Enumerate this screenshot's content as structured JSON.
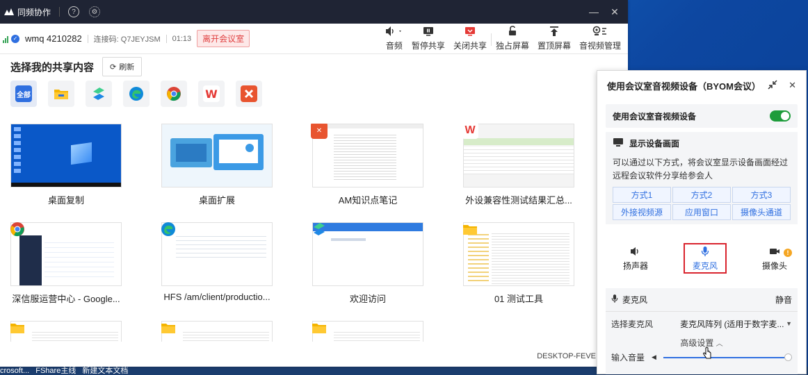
{
  "colors": {
    "accent": "#2f6fe0",
    "danger": "#e04040",
    "toggle_on": "#1e9c3b",
    "titlebar": "#1f2434",
    "highlight": "#d9232d"
  },
  "window": {
    "title": "同频协作",
    "help_icon": "help-circle-icon",
    "settings_icon": "gear-icon",
    "minimize": "—",
    "close": "✕"
  },
  "info": {
    "user": "wmq 4210282",
    "code": "连接码: Q7JEYJSM",
    "time": "01:13",
    "leave": "离开会议室"
  },
  "toolbar": [
    {
      "label": "音频",
      "icon": "speaker-icon"
    },
    {
      "label": "暂停共享",
      "icon": "pause-screen-icon"
    },
    {
      "label": "关闭共享",
      "icon": "stop-share-icon"
    },
    {
      "label": "独占屏幕",
      "icon": "lock-icon"
    },
    {
      "label": "置顶屏幕",
      "icon": "pin-top-icon"
    },
    {
      "label": "音视频管理",
      "icon": "av-manage-icon"
    }
  ],
  "share": {
    "title": "选择我的共享内容",
    "refresh": "刷新"
  },
  "filters": [
    {
      "name": "all",
      "label": "全部",
      "icon": "all-icon",
      "color": "#2f6fe0"
    },
    {
      "name": "explorer",
      "label": "",
      "icon": "folder-icon",
      "color": "#f4b400"
    },
    {
      "name": "app-s",
      "label": "",
      "icon": "s-app-icon",
      "color": "#22a36b"
    },
    {
      "name": "edge",
      "label": "",
      "icon": "edge-icon",
      "color": "#0f8ad8"
    },
    {
      "name": "chrome",
      "label": "",
      "icon": "chrome-icon",
      "color": "#db4437"
    },
    {
      "name": "wps",
      "label": "W",
      "icon": "wps-icon",
      "color": "#e53935"
    },
    {
      "name": "app-x",
      "label": "",
      "icon": "x-app-icon",
      "color": "#e8542f"
    }
  ],
  "cards": [
    {
      "label": "桌面复制"
    },
    {
      "label": "桌面扩展"
    },
    {
      "label": "AM知识点笔记"
    },
    {
      "label": "外设兼容性测试结果汇总..."
    },
    {
      "label": "深信服运营中心 - Google..."
    },
    {
      "label": "HFS /am/client/productio..."
    },
    {
      "label": "欢迎访问"
    },
    {
      "label": "01 测试工具"
    },
    {
      "label": ""
    },
    {
      "label": ""
    },
    {
      "label": ""
    }
  ],
  "desktop_label": "DESKTOP-FEVE",
  "taskbar": [
    "crosoft...",
    "FShare主线",
    "新建文本文档"
  ],
  "panel": {
    "title": "使用会议室音视频设备（BYOM会议）",
    "toggle_label": "使用会议室音视频设备",
    "toggle_on": true,
    "display_title": "显示设备画面",
    "display_desc": "可以通过以下方式，将会议室显示设备画面经过远程会议软件分享给参会人",
    "modes": [
      {
        "label": "方式1"
      },
      {
        "label": "方式2"
      },
      {
        "label": "方式3"
      },
      {
        "label": "外接视频源"
      },
      {
        "label": "应用窗口"
      },
      {
        "label": "摄像头通道"
      }
    ],
    "devices": [
      {
        "label": "扬声器",
        "icon": "speaker-icon"
      },
      {
        "label": "麦克风",
        "icon": "microphone-icon"
      },
      {
        "label": "摄像头",
        "icon": "camera-icon"
      }
    ],
    "mic_title": "麦克风",
    "mute": "静音",
    "select_label": "选择麦克风",
    "select_value": "麦克风阵列 (适用于数字麦...",
    "advanced": "高级设置",
    "volume_label": "输入音量",
    "volume_level": 1.0
  }
}
